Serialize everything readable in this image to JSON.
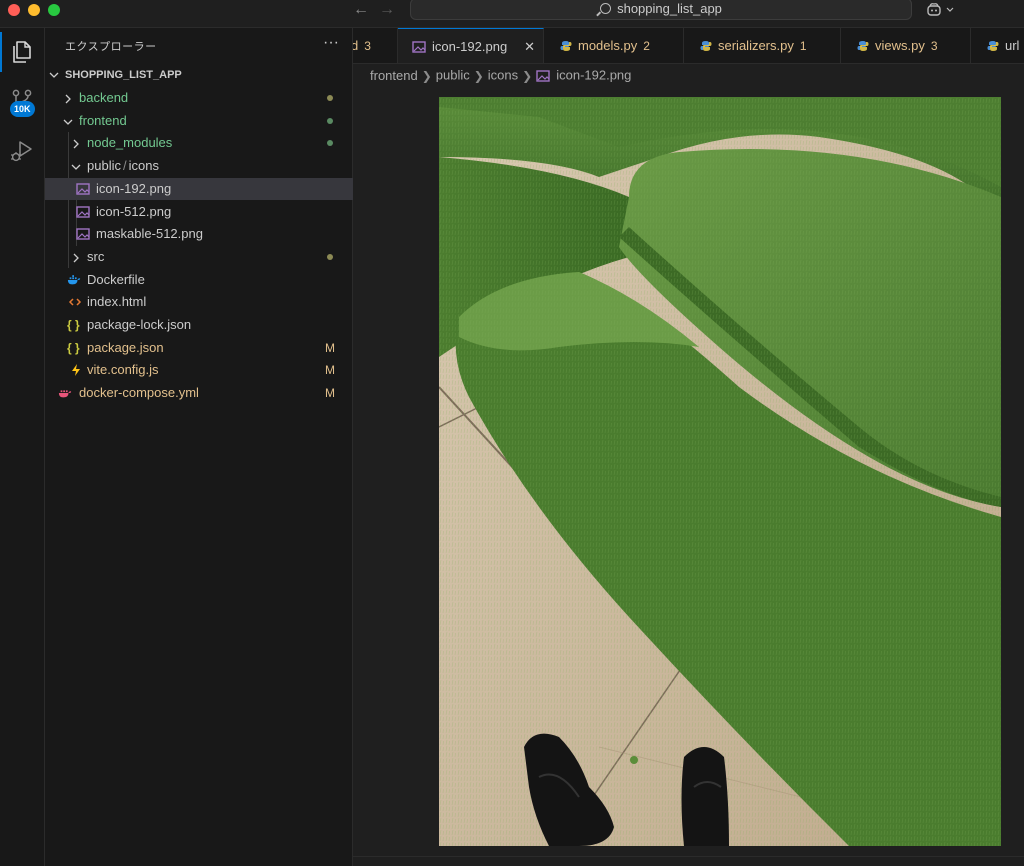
{
  "window": {
    "command_center": "shopping_list_app"
  },
  "activity_bar": {
    "source_control_badge": "10K"
  },
  "sidebar": {
    "title": "エクスプローラー",
    "more": "···",
    "project": "SHOPPING_LIST_APP",
    "items": [
      {
        "name": "backend",
        "type": "folder",
        "status": "dot"
      },
      {
        "name": "frontend",
        "type": "folder",
        "status": "dot"
      },
      {
        "name": "node_modules",
        "type": "folder",
        "status": "dot"
      },
      {
        "name": "public",
        "sep": "/",
        "name2": "icons",
        "type": "folder"
      },
      {
        "name": "icon-192.png",
        "type": "image"
      },
      {
        "name": "icon-512.png",
        "type": "image"
      },
      {
        "name": "maskable-512.png",
        "type": "image"
      },
      {
        "name": "src",
        "type": "folder",
        "status": "dot"
      },
      {
        "name": "Dockerfile",
        "type": "docker"
      },
      {
        "name": "index.html",
        "type": "html"
      },
      {
        "name": "package-lock.json",
        "type": "json"
      },
      {
        "name": "package.json",
        "type": "json",
        "status": "M"
      },
      {
        "name": "vite.config.js",
        "type": "vite",
        "status": "M"
      },
      {
        "name": "docker-compose.yml",
        "type": "compose",
        "status": "M"
      }
    ]
  },
  "tabs": [
    {
      "label": "d",
      "count": "3"
    },
    {
      "label": "icon-192.png",
      "close": "✕"
    },
    {
      "label": "models.py",
      "count": "2"
    },
    {
      "label": "serializers.py",
      "count": "1"
    },
    {
      "label": "views.py",
      "count": "3"
    },
    {
      "label": "url"
    }
  ],
  "breadcrumb": [
    "frontend",
    "public",
    "icons",
    "icon-192.png"
  ],
  "colors": {
    "accent": "#0078d4",
    "modified": "#e2c08d",
    "untracked": "#73c991",
    "grass": "#3a6a26",
    "floor": "#cdb99e"
  },
  "icons": {
    "explorer": "files-icon",
    "scm": "source-control-icon",
    "debug": "run-debug-icon"
  }
}
